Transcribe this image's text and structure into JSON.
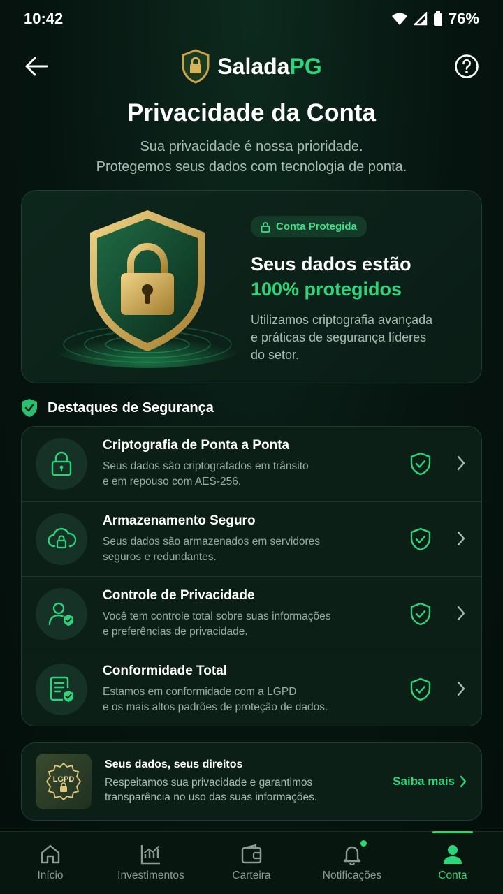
{
  "status_bar": {
    "time": "10:42",
    "battery": "76%"
  },
  "header": {
    "logo_part1": "Salada",
    "logo_part2": "PG"
  },
  "page": {
    "title": "Privacidade da Conta",
    "subtitle_line1": "Sua privacidade é nossa prioridade.",
    "subtitle_line2": "Protegemos seus dados com tecnologia de ponta."
  },
  "hero": {
    "badge": "Conta Protegida",
    "heading_line1": "Seus dados estão",
    "heading_line2": "100% protegidos",
    "desc_line1": "Utilizamos criptografia avançada",
    "desc_line2": "e práticas de segurança líderes",
    "desc_line3": "do setor."
  },
  "section": {
    "title": "Destaques de Segurança"
  },
  "features": [
    {
      "title": "Criptografia de Ponta a Ponta",
      "desc1": "Seus dados são criptografados em trânsito",
      "desc2": "e em repouso com AES-256.",
      "icon": "lock-icon"
    },
    {
      "title": "Armazenamento Seguro",
      "desc1": "Seus dados são armazenados em servidores",
      "desc2": "seguros e redundantes.",
      "icon": "cloud-lock-icon"
    },
    {
      "title": "Controle de Privacidade",
      "desc1": "Você tem controle total sobre suas informações",
      "desc2": "e preferências de privacidade.",
      "icon": "user-shield-icon"
    },
    {
      "title": "Conformidade Total",
      "desc1": "Estamos em conformidade com a LGPD",
      "desc2": "e os mais altos padrões de proteção de dados.",
      "icon": "document-shield-icon"
    }
  ],
  "rights": {
    "badge_text": "LGPD",
    "title": "Seus dados, seus direitos",
    "desc_line1": "Respeitamos sua privacidade e garantimos",
    "desc_line2": "transparência no uso das suas informações.",
    "link": "Saiba mais"
  },
  "nav": {
    "items": [
      {
        "label": "Início",
        "icon": "home-icon"
      },
      {
        "label": "Investimentos",
        "icon": "chart-icon"
      },
      {
        "label": "Carteira",
        "icon": "wallet-icon"
      },
      {
        "label": "Notificações",
        "icon": "bell-icon"
      },
      {
        "label": "Conta",
        "icon": "user-icon",
        "active": true
      }
    ]
  },
  "colors": {
    "accent": "#2ed47a",
    "background": "#061510",
    "card": "#0b1f17"
  }
}
